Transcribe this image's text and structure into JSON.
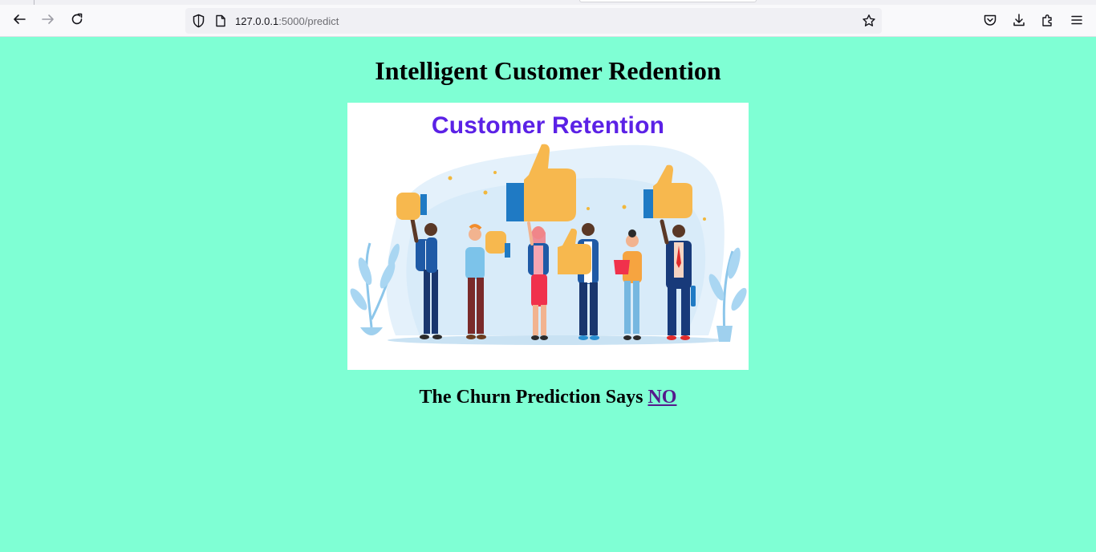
{
  "browser": {
    "url_host": "127.0.0.1",
    "url_rest": ":5000/predict"
  },
  "page": {
    "heading": "Intelligent Customer Redention",
    "image_caption": "Customer Retention",
    "result_prefix": "The Churn Prediction Says",
    "result_value": "NO"
  },
  "colors": {
    "page_background": "#7fffd4",
    "link": "#551a8b",
    "image_title": "#5b21e6"
  },
  "icons": {
    "back": "back-arrow-icon",
    "forward": "forward-arrow-icon",
    "reload": "reload-icon",
    "shield": "tracking-shield-icon",
    "page": "page-icon",
    "bookmark": "star-icon",
    "pocket": "pocket-icon",
    "downloads": "download-icon",
    "extensions": "puzzle-icon",
    "menu": "hamburger-menu-icon"
  }
}
